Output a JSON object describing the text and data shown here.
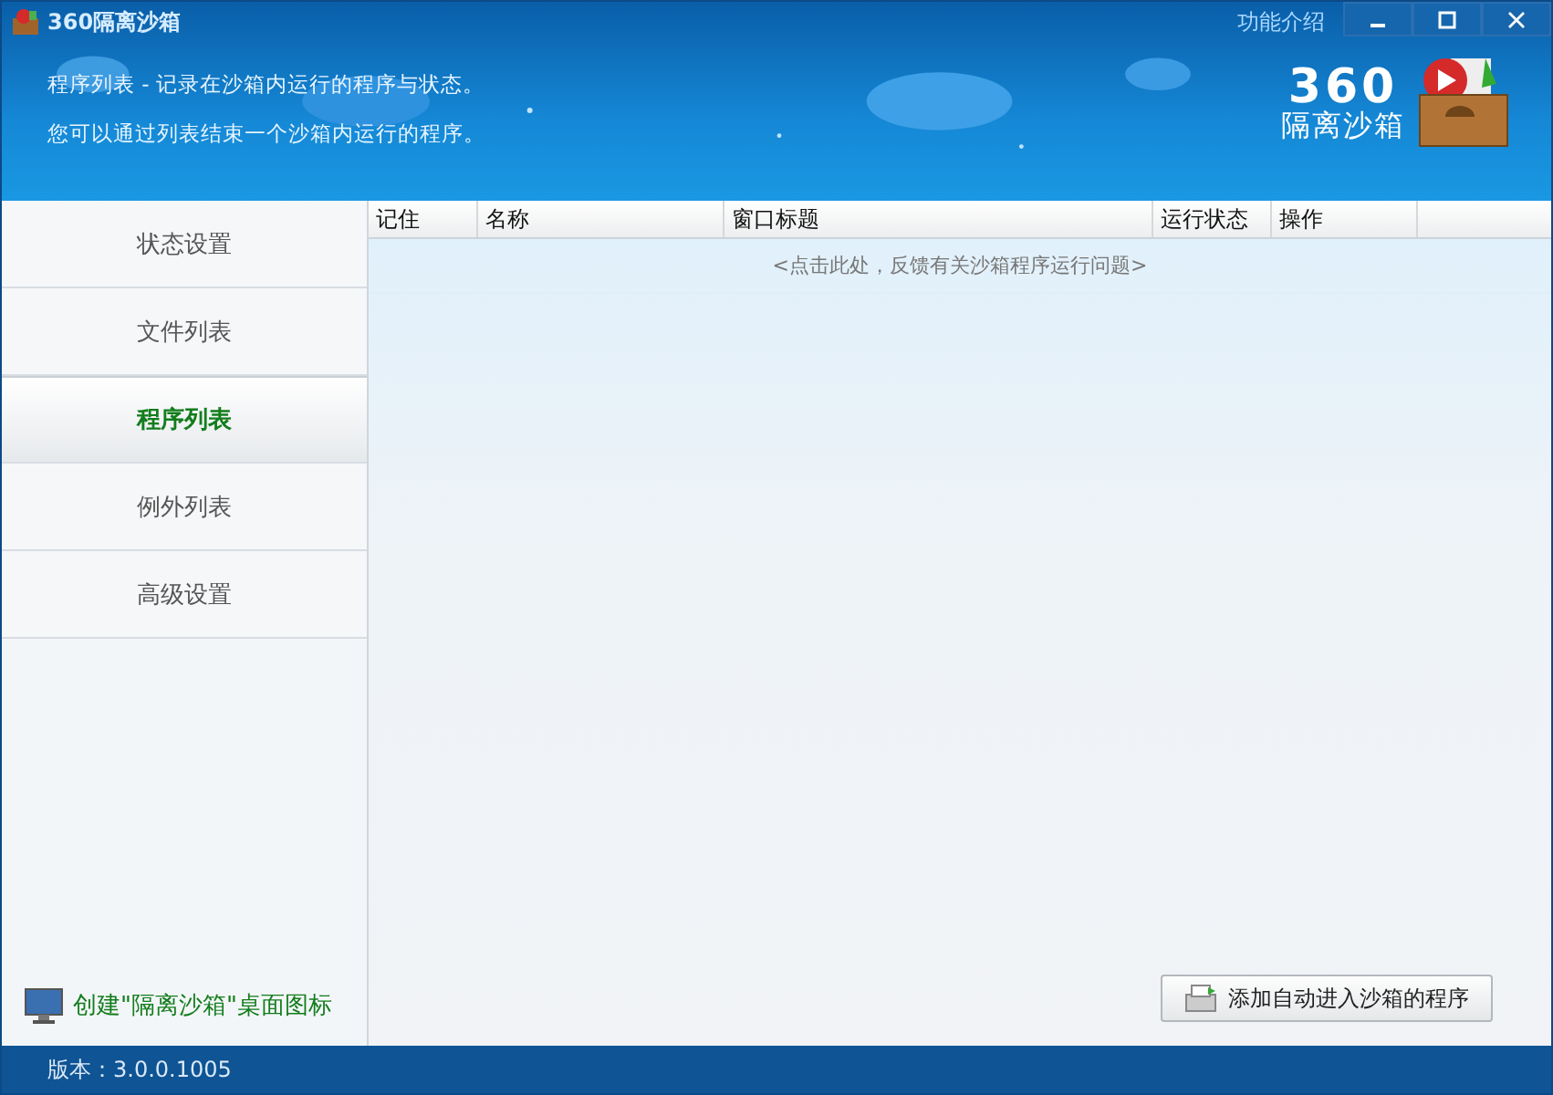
{
  "window": {
    "title": "360隔离沙箱",
    "help_link": "功能介绍"
  },
  "header": {
    "lines": [
      "程序列表 - 记录在沙箱内运行的程序与状态。",
      "您可以通过列表结束一个沙箱内运行的程序。"
    ],
    "logo_number": "360",
    "logo_text": "隔离沙箱"
  },
  "sidebar": {
    "items": [
      {
        "label": "状态设置",
        "selected": false
      },
      {
        "label": "文件列表",
        "selected": false
      },
      {
        "label": "程序列表",
        "selected": true
      },
      {
        "label": "例外列表",
        "selected": false
      },
      {
        "label": "高级设置",
        "selected": false
      }
    ],
    "shortcut_link": "创建\"隔离沙箱\"桌面图标"
  },
  "table": {
    "columns": [
      "记住",
      "名称",
      "窗口标题",
      "运行状态",
      "操作"
    ],
    "feedback_link": "<点击此处，反馈有关沙箱程序运行问题>"
  },
  "add_button": "添加自动进入沙箱的程序",
  "status_bar": "版本：3.0.0.1005"
}
